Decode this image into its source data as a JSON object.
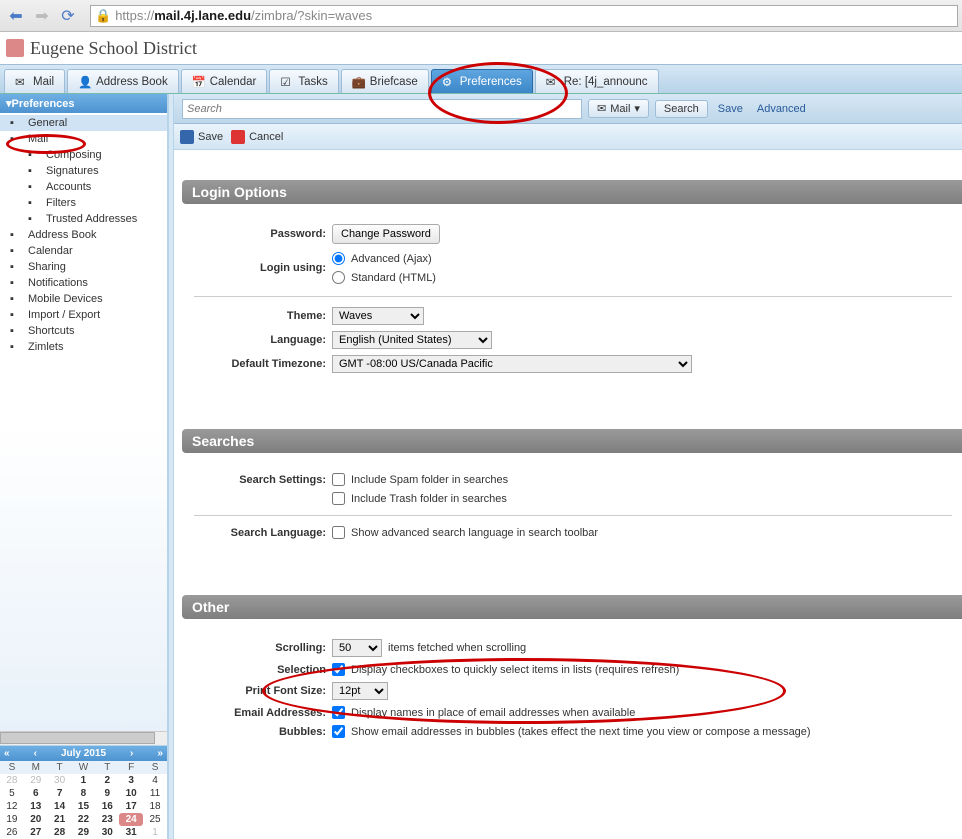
{
  "browser": {
    "url_proto": "https",
    "url_host": "mail.4j.lane.edu",
    "url_path": "/zimbra/?skin=waves"
  },
  "app_title": "Eugene School District",
  "tabs": {
    "mail": "Mail",
    "address_book": "Address Book",
    "calendar": "Calendar",
    "tasks": "Tasks",
    "briefcase": "Briefcase",
    "preferences": "Preferences",
    "re_label": "Re: [4j_announc"
  },
  "searchbar": {
    "placeholder": "Search",
    "mail_btn": "Mail",
    "search_btn": "Search",
    "save_link": "Save",
    "advanced_link": "Advanced"
  },
  "save_bar": {
    "save": "Save",
    "cancel": "Cancel"
  },
  "sidebar": {
    "header": "Preferences",
    "items": [
      {
        "label": "General",
        "selected": true
      },
      {
        "label": "Mail"
      },
      {
        "label": "Composing",
        "sub": true
      },
      {
        "label": "Signatures",
        "sub": true
      },
      {
        "label": "Accounts",
        "sub": true
      },
      {
        "label": "Filters",
        "sub": true
      },
      {
        "label": "Trusted Addresses",
        "sub": true
      },
      {
        "label": "Address Book"
      },
      {
        "label": "Calendar"
      },
      {
        "label": "Sharing"
      },
      {
        "label": "Notifications"
      },
      {
        "label": "Mobile Devices"
      },
      {
        "label": "Import / Export"
      },
      {
        "label": "Shortcuts"
      },
      {
        "label": "Zimlets"
      }
    ]
  },
  "login_panel": {
    "title": "Login Options",
    "password_label": "Password:",
    "change_pw_btn": "Change Password",
    "login_using_label": "Login using:",
    "advanced_ajax": "Advanced (Ajax)",
    "standard_html": "Standard (HTML)",
    "theme_label": "Theme:",
    "theme_value": "Waves",
    "language_label": "Language:",
    "language_value": "English (United States)",
    "timezone_label": "Default Timezone:",
    "timezone_value": "GMT -08:00 US/Canada Pacific"
  },
  "searches_panel": {
    "title": "Searches",
    "settings_label": "Search Settings:",
    "include_spam": "Include Spam folder in searches",
    "include_trash": "Include Trash folder in searches",
    "lang_label": "Search Language:",
    "show_adv": "Show advanced search language in search toolbar"
  },
  "other_panel": {
    "title": "Other",
    "scrolling_label": "Scrolling:",
    "scrolling_value": "50",
    "scrolling_suffix": "items fetched when scrolling",
    "selection_label": "Selection",
    "selection_text": "Display checkboxes to quickly select items in lists (requires refresh)",
    "font_label": "Print Font Size:",
    "font_value": "12pt",
    "email_label": "Email Addresses:",
    "email_text": "Display names in place of email addresses when available",
    "bubbles_label": "Bubbles:",
    "bubbles_text": "Show email addresses in bubbles (takes effect the next time you view or compose a message)"
  },
  "calendar": {
    "month": "July 2015",
    "dow": [
      "S",
      "M",
      "T",
      "W",
      "T",
      "F",
      "S"
    ],
    "weeks": [
      [
        {
          "d": "28",
          "dim": true
        },
        {
          "d": "29",
          "dim": true
        },
        {
          "d": "30",
          "dim": true
        },
        {
          "d": "1",
          "b": true
        },
        {
          "d": "2",
          "b": true
        },
        {
          "d": "3",
          "b": true
        },
        {
          "d": "4"
        }
      ],
      [
        {
          "d": "5"
        },
        {
          "d": "6",
          "b": true
        },
        {
          "d": "7",
          "b": true
        },
        {
          "d": "8",
          "b": true
        },
        {
          "d": "9",
          "b": true
        },
        {
          "d": "10",
          "b": true
        },
        {
          "d": "11"
        }
      ],
      [
        {
          "d": "12"
        },
        {
          "d": "13",
          "b": true
        },
        {
          "d": "14",
          "b": true
        },
        {
          "d": "15",
          "b": true
        },
        {
          "d": "16",
          "b": true
        },
        {
          "d": "17",
          "b": true
        },
        {
          "d": "18"
        }
      ],
      [
        {
          "d": "19"
        },
        {
          "d": "20",
          "b": true
        },
        {
          "d": "21",
          "b": true
        },
        {
          "d": "22",
          "b": true
        },
        {
          "d": "23",
          "b": true
        },
        {
          "d": "24",
          "b": true,
          "today": true
        },
        {
          "d": "25"
        }
      ],
      [
        {
          "d": "26"
        },
        {
          "d": "27",
          "b": true
        },
        {
          "d": "28",
          "b": true
        },
        {
          "d": "29",
          "b": true
        },
        {
          "d": "30",
          "b": true
        },
        {
          "d": "31",
          "b": true
        },
        {
          "d": "1",
          "dim": true
        }
      ]
    ]
  }
}
